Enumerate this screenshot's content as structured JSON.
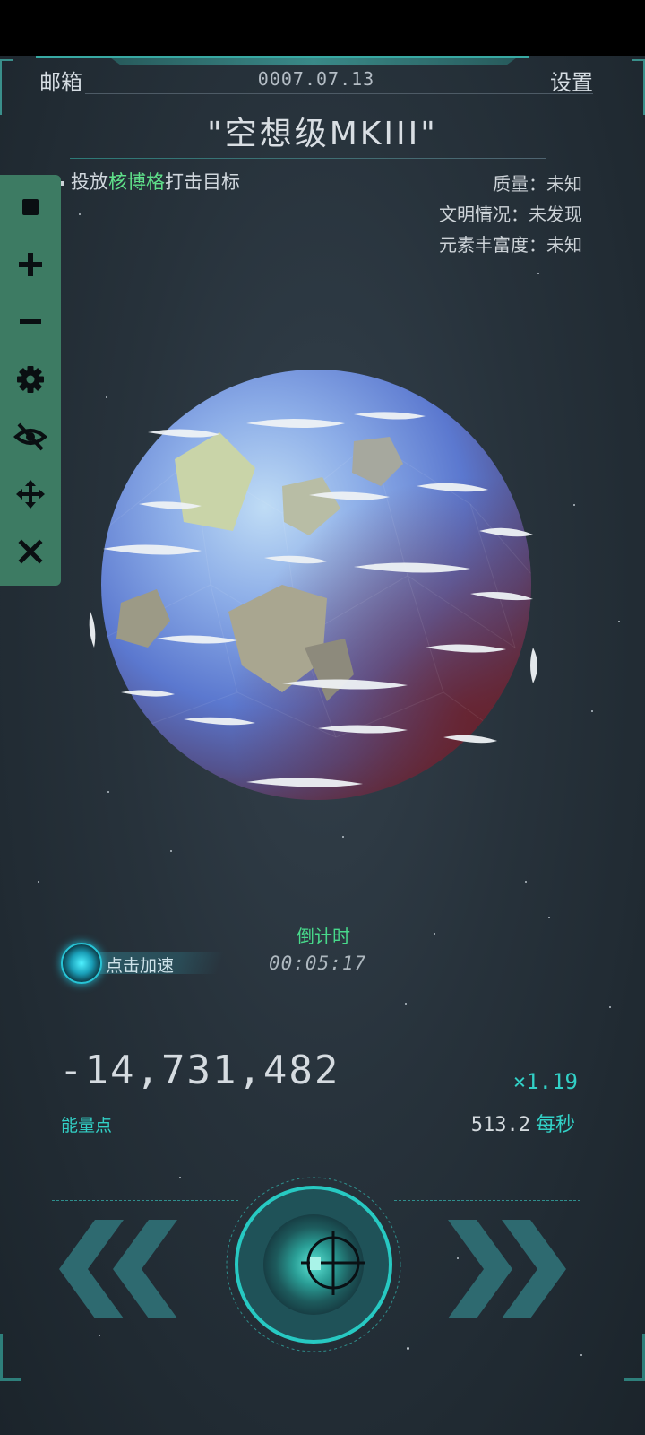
{
  "header": {
    "mailbox_label": "邮箱",
    "date": "0007.07.13",
    "settings_label": "设置"
  },
  "ship": {
    "name": "\"空想级MKIII\""
  },
  "mission": {
    "prefix": "投放",
    "weapon": "核博格",
    "suffix": "打击目标"
  },
  "planet_info": {
    "quality": "质量：未知",
    "civilization": "文明情况：未发现",
    "elements": "元素丰富度：未知"
  },
  "toolbar": {
    "items": [
      "stop-icon",
      "plus-icon",
      "minus-icon",
      "gear-icon",
      "eye-off-icon",
      "move-icon",
      "close-icon"
    ],
    "bg_color": "#3d7b63"
  },
  "speedup": {
    "label": "点击加速"
  },
  "countdown": {
    "label": "倒计时",
    "time": "00:05:17"
  },
  "energy": {
    "value": "-14,731,482",
    "label": "能量点",
    "multiplier": "×1.19",
    "rate_value": "513.2",
    "rate_unit": "每秒"
  },
  "controls": {
    "prev": "chevrons-left-icon",
    "fire": "crosshair-icon",
    "next": "chevrons-right-icon"
  },
  "colors": {
    "accent": "#32d0c6",
    "highlight": "#5fe08a",
    "countdown_label": "#48d98b"
  }
}
